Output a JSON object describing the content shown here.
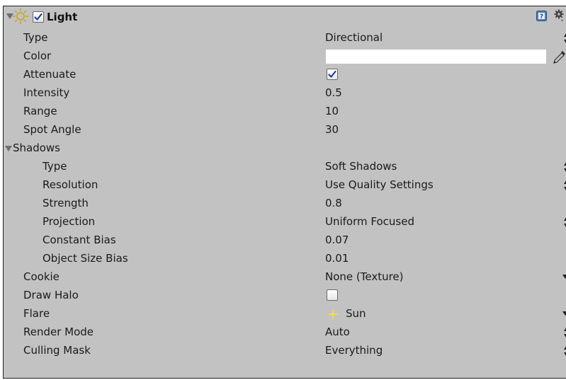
{
  "component": {
    "title": "Light",
    "enabled": true,
    "icons": [
      "sun-icon",
      "help-icon",
      "gear-icon"
    ]
  },
  "rows": {
    "type": {
      "label": "Type",
      "value": "Directional"
    },
    "color": {
      "label": "Color",
      "value": "#ffffff"
    },
    "attenuate": {
      "label": "Attenuate",
      "checked": true
    },
    "intensity": {
      "label": "Intensity",
      "value": "0.5"
    },
    "range": {
      "label": "Range",
      "value": "10"
    },
    "spot_angle": {
      "label": "Spot Angle",
      "value": "30"
    },
    "shadows": {
      "label": "Shadows",
      "expanded": true
    },
    "shadow_type": {
      "label": "Type",
      "value": "Soft Shadows"
    },
    "resolution": {
      "label": "Resolution",
      "value": "Use Quality Settings"
    },
    "strength": {
      "label": "Strength",
      "value": "0.8"
    },
    "projection": {
      "label": "Projection",
      "value": "Uniform Focused"
    },
    "constant_bias": {
      "label": "Constant Bias",
      "value": "0.07"
    },
    "object_size_bias": {
      "label": "Object Size Bias",
      "value": "0.01"
    },
    "cookie": {
      "label": "Cookie",
      "value": "None (Texture)"
    },
    "draw_halo": {
      "label": "Draw Halo",
      "checked": false
    },
    "flare": {
      "label": "Flare",
      "value": "Sun",
      "icon": "flare-sparkle-icon"
    },
    "render_mode": {
      "label": "Render Mode",
      "value": "Auto"
    },
    "culling_mask": {
      "label": "Culling Mask",
      "value": "Everything"
    }
  },
  "colors": {
    "panel_bg": "#c2c2c2",
    "checkbox_check": "#1f3f9a",
    "sun_icon": "#d6b21c",
    "flare_icon": "#f5e33a"
  }
}
